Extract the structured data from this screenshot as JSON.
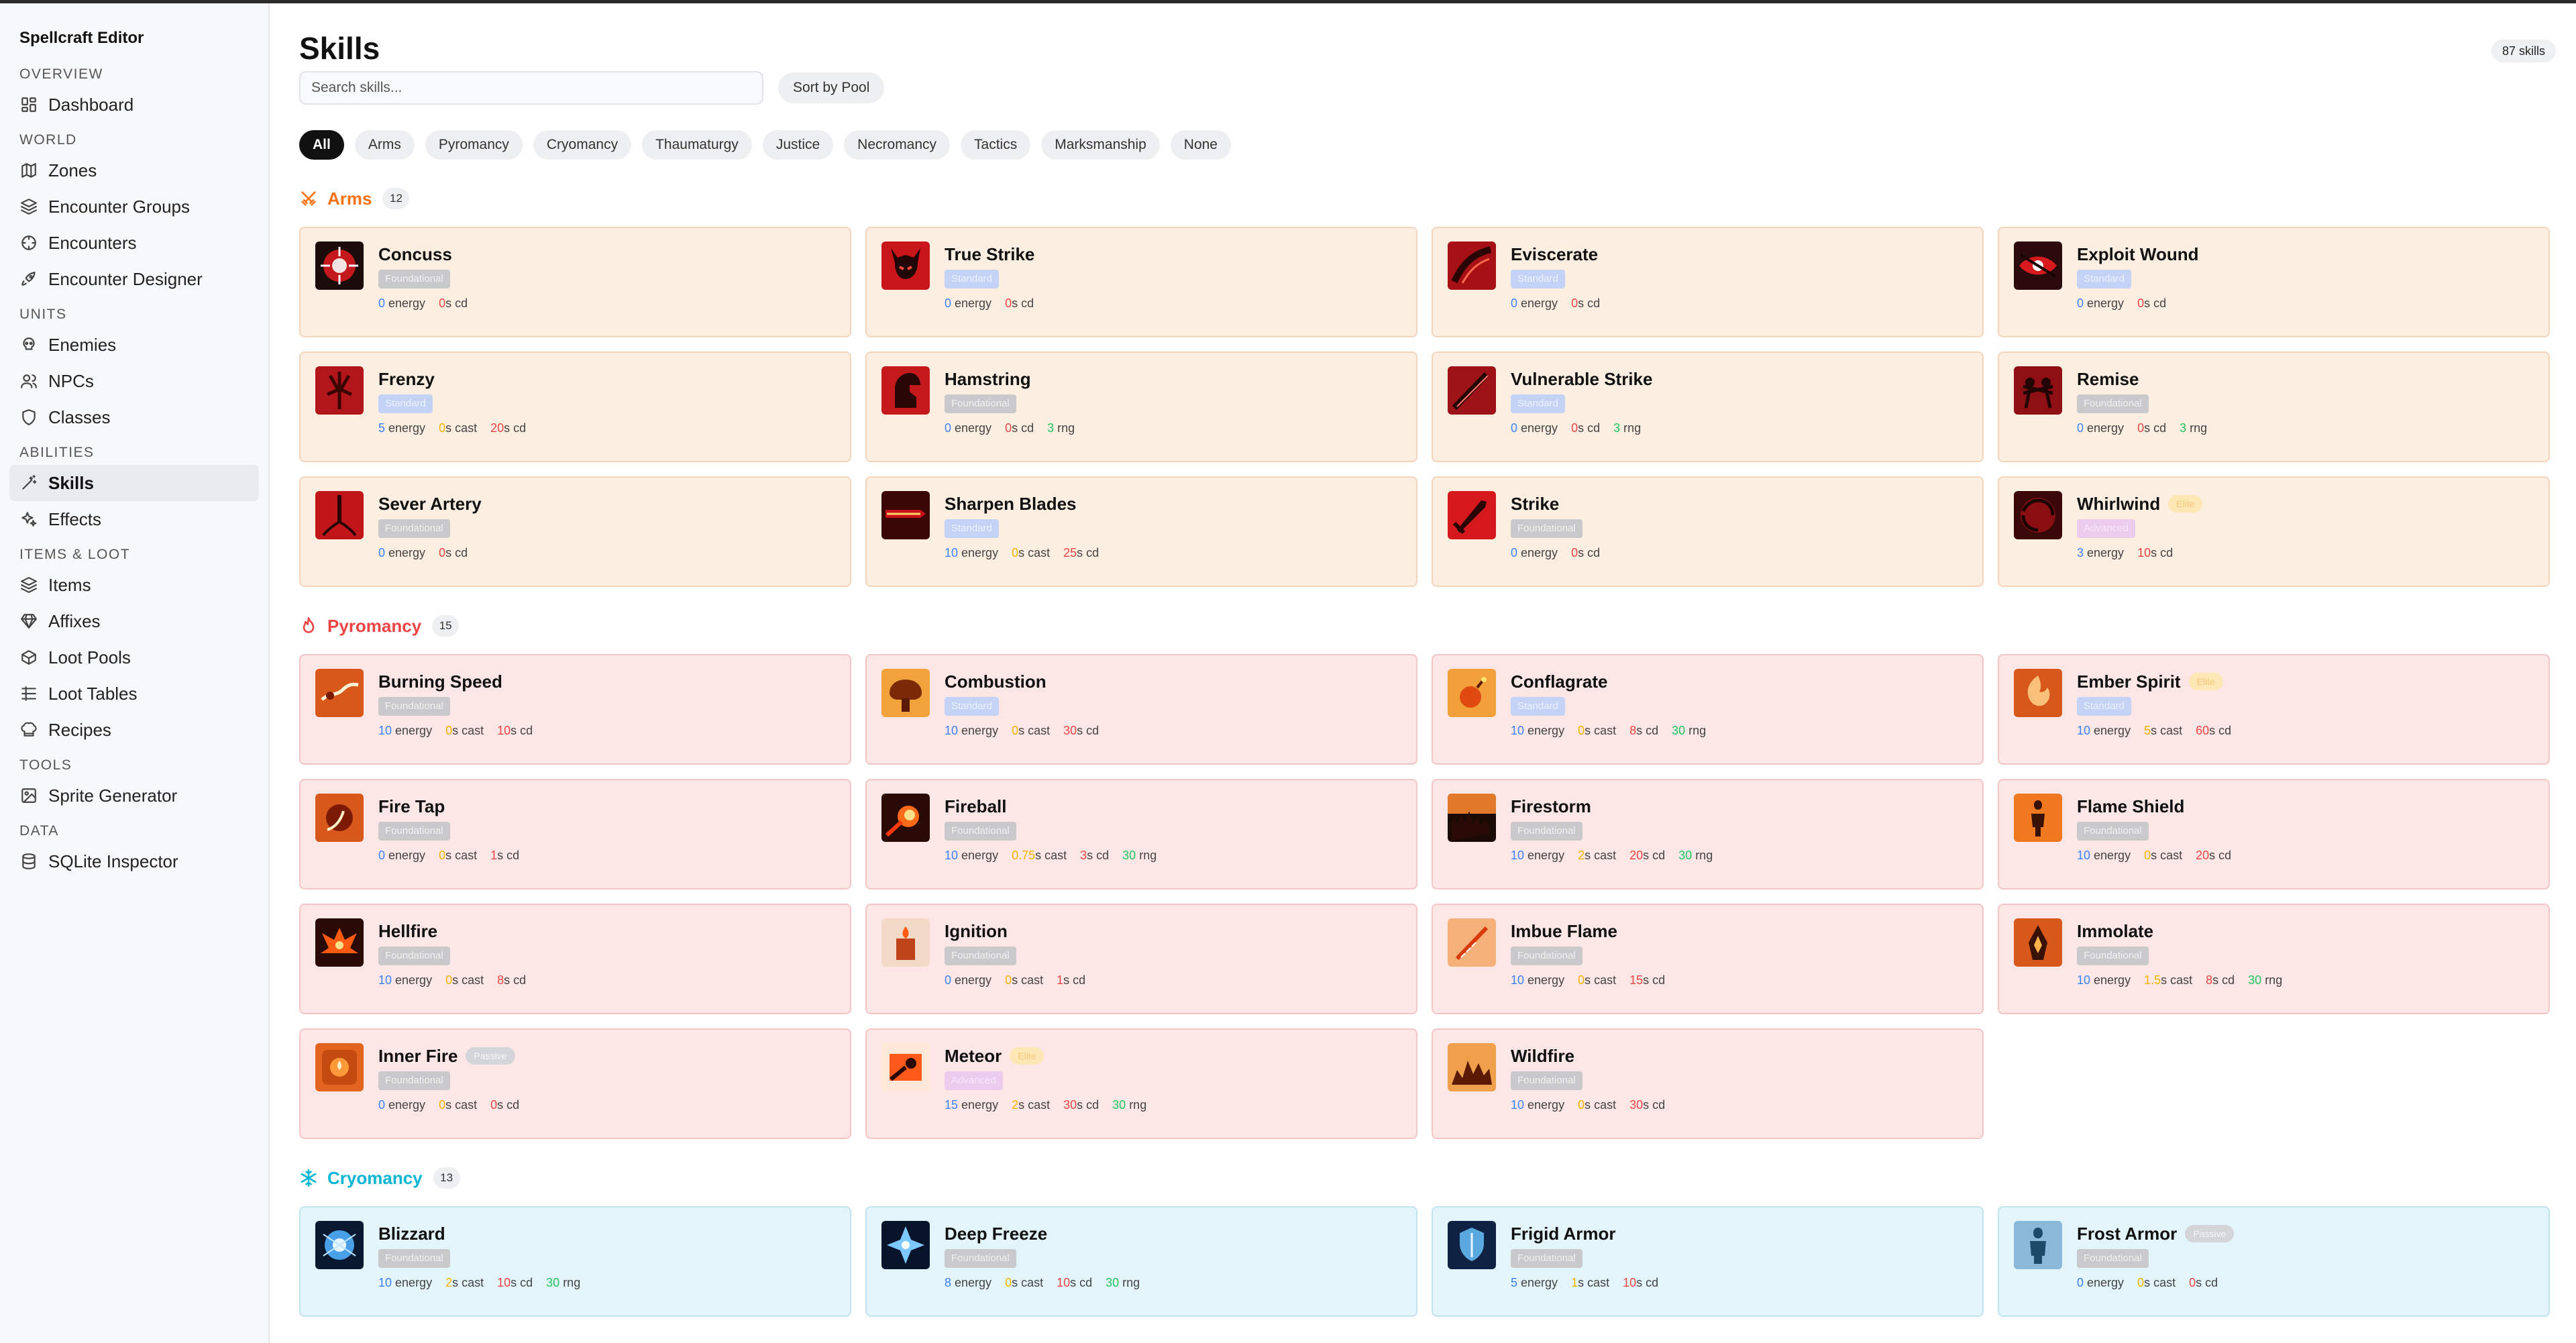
{
  "app": {
    "title": "Spellcraft Editor"
  },
  "sidebar": {
    "sections": [
      {
        "label": "OVERVIEW",
        "items": [
          {
            "label": "Dashboard",
            "icon": "dashboard-icon"
          }
        ]
      },
      {
        "label": "WORLD",
        "items": [
          {
            "label": "Zones",
            "icon": "map-icon"
          },
          {
            "label": "Encounter Groups",
            "icon": "layers-icon"
          },
          {
            "label": "Encounters",
            "icon": "crosshair-icon"
          },
          {
            "label": "Encounter Designer",
            "icon": "rocket-icon"
          }
        ]
      },
      {
        "label": "UNITS",
        "items": [
          {
            "label": "Enemies",
            "icon": "skull-icon"
          },
          {
            "label": "NPCs",
            "icon": "users-icon"
          },
          {
            "label": "Classes",
            "icon": "shield-icon"
          }
        ]
      },
      {
        "label": "ABILITIES",
        "items": [
          {
            "label": "Skills",
            "icon": "wand-icon",
            "active": true
          },
          {
            "label": "Effects",
            "icon": "sparkles-icon"
          }
        ]
      },
      {
        "label": "ITEMS & LOOT",
        "items": [
          {
            "label": "Items",
            "icon": "layers-icon"
          },
          {
            "label": "Affixes",
            "icon": "gem-icon"
          },
          {
            "label": "Loot Pools",
            "icon": "box-icon"
          },
          {
            "label": "Loot Tables",
            "icon": "table-icon"
          },
          {
            "label": "Recipes",
            "icon": "chef-hat-icon"
          }
        ]
      },
      {
        "label": "TOOLS",
        "items": [
          {
            "label": "Sprite Generator",
            "icon": "image-icon"
          }
        ]
      },
      {
        "label": "DATA",
        "items": [
          {
            "label": "SQLite Inspector",
            "icon": "database-icon"
          }
        ]
      }
    ]
  },
  "header": {
    "title": "Skills",
    "count_badge": "87 skills"
  },
  "toolbar": {
    "search_placeholder": "Search skills...",
    "sort_label": "Sort by Pool"
  },
  "filters": [
    "All",
    "Arms",
    "Pyromancy",
    "Cryomancy",
    "Thaumaturgy",
    "Justice",
    "Necromancy",
    "Tactics",
    "Marksmanship",
    "None"
  ],
  "active_filter": "All",
  "units": {
    "energy": "energy",
    "cast": "s cast",
    "cd": "s cd",
    "rng": "rng"
  },
  "colors": {
    "energy": "#3b82f6",
    "cast": "#f5b400",
    "cd": "#ef4444",
    "rng": "#22c55e",
    "arms": "#f97316",
    "pyromancy": "#ef4444",
    "cryomancy": "#06b6d4"
  },
  "pools": [
    {
      "key": "arms",
      "name": "Arms",
      "count": "12",
      "color": "#f97316",
      "icon": "crossed-swords-icon",
      "skills": [
        {
          "name": "Concuss",
          "tier": "Foundational",
          "energy": "0",
          "cd": "0",
          "art": "concuss"
        },
        {
          "name": "True Strike",
          "tier": "Standard",
          "energy": "0",
          "cd": "0",
          "art": "demon"
        },
        {
          "name": "Eviscerate",
          "tier": "Standard",
          "energy": "0",
          "cd": "0",
          "art": "claw"
        },
        {
          "name": "Exploit Wound",
          "tier": "Standard",
          "energy": "0",
          "cd": "0",
          "art": "eye"
        },
        {
          "name": "Frenzy",
          "tier": "Standard",
          "energy": "5",
          "cast": "0",
          "cd": "20",
          "art": "frenzy"
        },
        {
          "name": "Hamstring",
          "tier": "Foundational",
          "energy": "0",
          "cd": "0",
          "rng": "3",
          "art": "head"
        },
        {
          "name": "Vulnerable Strike",
          "tier": "Standard",
          "energy": "0",
          "cd": "0",
          "rng": "3",
          "art": "blade"
        },
        {
          "name": "Remise",
          "tier": "Foundational",
          "energy": "0",
          "cd": "0",
          "rng": "3",
          "art": "duel"
        },
        {
          "name": "Sever Artery",
          "tier": "Foundational",
          "energy": "0",
          "cd": "0",
          "art": "artery"
        },
        {
          "name": "Sharpen Blades",
          "tier": "Standard",
          "energy": "10",
          "cast": "0",
          "cd": "25",
          "art": "sharpen"
        },
        {
          "name": "Strike",
          "tier": "Foundational",
          "energy": "0",
          "cd": "0",
          "art": "sword"
        },
        {
          "name": "Whirlwind",
          "badge": "Elite",
          "tier": "Advanced",
          "energy": "3",
          "cd": "10",
          "art": "whirl"
        }
      ]
    },
    {
      "key": "pyro",
      "name": "Pyromancy",
      "count": "15",
      "color": "#ef4444",
      "icon": "flame-icon",
      "skills": [
        {
          "name": "Burning Speed",
          "tier": "Foundational",
          "energy": "10",
          "cast": "0",
          "cd": "10",
          "art": "speed"
        },
        {
          "name": "Combustion",
          "tier": "Standard",
          "energy": "10",
          "cast": "0",
          "cd": "30",
          "art": "explosion"
        },
        {
          "name": "Conflagrate",
          "tier": "Standard",
          "energy": "10",
          "cast": "0",
          "cd": "8",
          "rng": "30",
          "art": "bomb"
        },
        {
          "name": "Ember Spirit",
          "badge": "Elite",
          "tier": "Standard",
          "energy": "10",
          "cast": "5",
          "cd": "60",
          "art": "spirit"
        },
        {
          "name": "Fire Tap",
          "tier": "Foundational",
          "energy": "0",
          "cast": "0",
          "cd": "1",
          "art": "orb"
        },
        {
          "name": "Fireball",
          "tier": "Foundational",
          "energy": "10",
          "cast": "0.75",
          "cd": "3",
          "rng": "30",
          "art": "fireball"
        },
        {
          "name": "Firestorm",
          "tier": "Foundational",
          "energy": "10",
          "cast": "2",
          "cd": "20",
          "rng": "30",
          "art": "storm"
        },
        {
          "name": "Flame Shield",
          "tier": "Foundational",
          "energy": "10",
          "cast": "0",
          "cd": "20",
          "art": "shield"
        },
        {
          "name": "Hellfire",
          "tier": "Foundational",
          "energy": "10",
          "cast": "0",
          "cd": "8",
          "art": "hell"
        },
        {
          "name": "Ignition",
          "tier": "Foundational",
          "energy": "0",
          "cast": "0",
          "cd": "1",
          "art": "torch"
        },
        {
          "name": "Imbue Flame",
          "tier": "Foundational",
          "energy": "10",
          "cast": "0",
          "cd": "15",
          "art": "imbue"
        },
        {
          "name": "Immolate",
          "tier": "Foundational",
          "energy": "10",
          "cast": "1.5",
          "cd": "8",
          "rng": "30",
          "art": "immolate"
        },
        {
          "name": "Inner Fire",
          "badge": "Passive",
          "tier": "Foundational",
          "energy": "0",
          "cast": "0",
          "cd": "0",
          "art": "inner"
        },
        {
          "name": "Meteor",
          "badge": "Elite",
          "tier": "Advanced",
          "energy": "15",
          "cast": "2",
          "cd": "30",
          "rng": "30",
          "art": "meteor"
        },
        {
          "name": "Wildfire",
          "tier": "Foundational",
          "energy": "10",
          "cast": "0",
          "cd": "30",
          "art": "wildfire"
        }
      ]
    },
    {
      "key": "cryo",
      "name": "Cryomancy",
      "count": "13",
      "color": "#06b6d4",
      "icon": "snowflake-icon",
      "skills": [
        {
          "name": "Blizzard",
          "tier": "Foundational",
          "energy": "10",
          "cast": "2",
          "cd": "10",
          "rng": "30",
          "art": "blizzard"
        },
        {
          "name": "Deep Freeze",
          "tier": "Foundational",
          "energy": "8",
          "cast": "0",
          "cd": "10",
          "rng": "30",
          "art": "freeze"
        },
        {
          "name": "Frigid Armor",
          "tier": "Foundational",
          "energy": "5",
          "cast": "1",
          "cd": "10",
          "art": "armor"
        },
        {
          "name": "Frost Armor",
          "badge": "Passive",
          "tier": "Foundational",
          "energy": "0",
          "cast": "0",
          "cd": "0",
          "art": "frost"
        }
      ]
    }
  ]
}
